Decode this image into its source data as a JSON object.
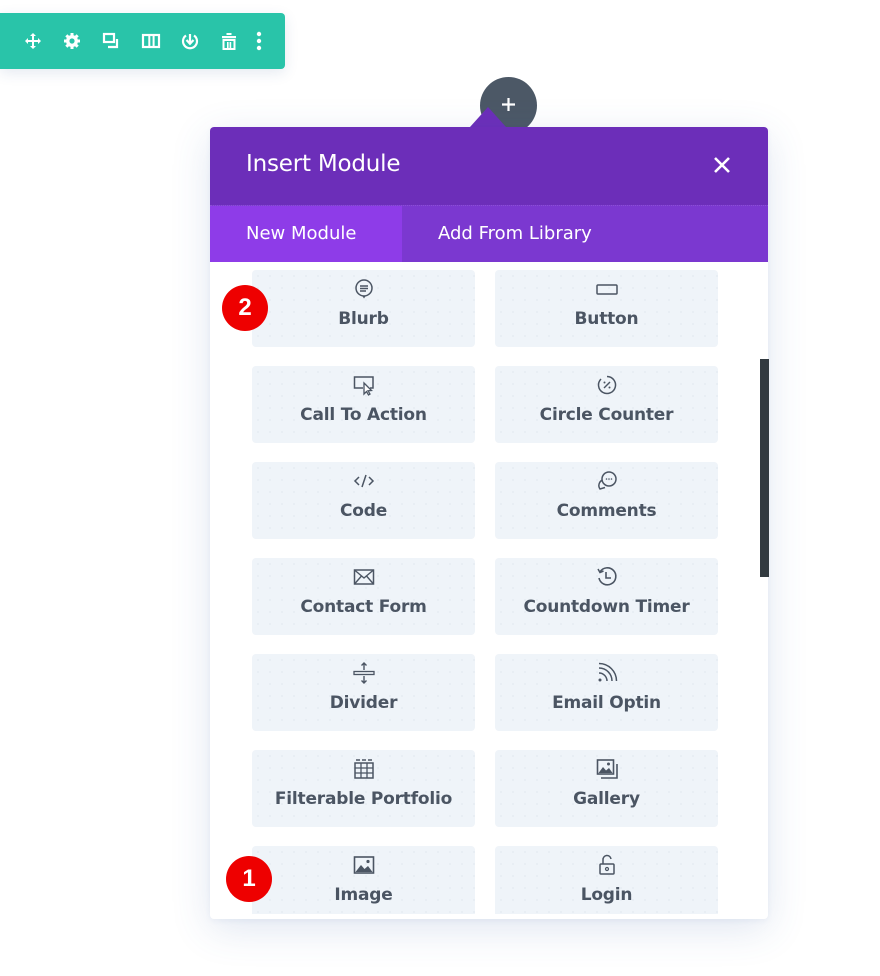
{
  "toolbar": {
    "color": "#29c4a9",
    "icons": [
      {
        "name": "move-icon",
        "label": "Move"
      },
      {
        "name": "gear-icon",
        "label": "Settings"
      },
      {
        "name": "duplicate-icon",
        "label": "Duplicate"
      },
      {
        "name": "columns-icon",
        "label": "Columns"
      },
      {
        "name": "save-to-library-icon",
        "label": "Save to Library"
      },
      {
        "name": "trash-icon",
        "label": "Delete"
      },
      {
        "name": "more-options-icon",
        "label": "More"
      }
    ]
  },
  "add_button": {
    "icon": "plus-icon",
    "color": "#4c5866"
  },
  "modal": {
    "title": "Insert Module",
    "close_icon": "close-icon",
    "header_color": "#6c2eb9",
    "tabs": [
      {
        "label": "New Module",
        "active": true,
        "color": "#8e3ce8"
      },
      {
        "label": "Add From Library",
        "active": false,
        "color": "#7b38d0"
      }
    ],
    "modules": [
      {
        "label": "Blurb",
        "icon": "blurb-icon"
      },
      {
        "label": "Button",
        "icon": "button-icon"
      },
      {
        "label": "Call To Action",
        "icon": "call-to-action-icon"
      },
      {
        "label": "Circle Counter",
        "icon": "circle-counter-icon"
      },
      {
        "label": "Code",
        "icon": "code-icon"
      },
      {
        "label": "Comments",
        "icon": "comments-icon"
      },
      {
        "label": "Contact Form",
        "icon": "envelope-icon"
      },
      {
        "label": "Countdown Timer",
        "icon": "countdown-timer-icon"
      },
      {
        "label": "Divider",
        "icon": "divider-icon"
      },
      {
        "label": "Email Optin",
        "icon": "rss-icon"
      },
      {
        "label": "Filterable Portfolio",
        "icon": "grid-table-icon"
      },
      {
        "label": "Gallery",
        "icon": "gallery-icon"
      },
      {
        "label": "Image",
        "icon": "image-icon"
      },
      {
        "label": "Login",
        "icon": "unlock-icon"
      }
    ]
  },
  "annotations": [
    {
      "label": "2",
      "target": "Blurb",
      "color": "#ee0000"
    },
    {
      "label": "1",
      "target": "Image",
      "color": "#ee0000"
    }
  ]
}
